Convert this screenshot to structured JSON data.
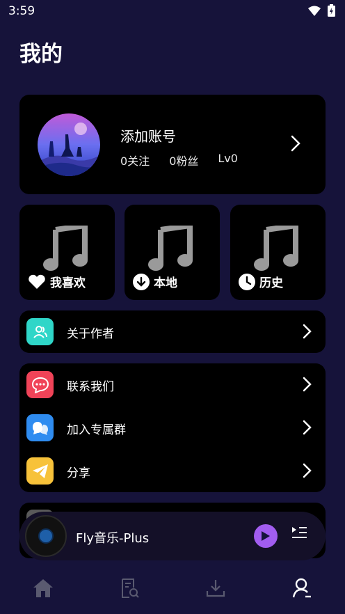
{
  "status": {
    "time": "3:59"
  },
  "page": {
    "title": "我的"
  },
  "profile": {
    "name": "添加账号",
    "following": "0关注",
    "followers": "0粉丝",
    "level": "Lv0"
  },
  "tiles": [
    {
      "label": "我喜欢",
      "icon": "heart-icon"
    },
    {
      "label": "本地",
      "icon": "download-icon"
    },
    {
      "label": "历史",
      "icon": "clock-icon"
    }
  ],
  "menu": {
    "about": {
      "label": "关于作者",
      "icon": "users-icon",
      "color": "#2fd6c8"
    },
    "contact": {
      "label": "联系我们",
      "icon": "message-icon",
      "color": "#f04358"
    },
    "join_group": {
      "label": "加入专属群",
      "icon": "group-chat-icon",
      "color": "#2f8cf0"
    },
    "share": {
      "label": "分享",
      "icon": "paper-plane-icon",
      "color": "#f7c23a"
    }
  },
  "player": {
    "title": "Fly音乐-Plus",
    "accent": "#a25df0"
  },
  "nav": {
    "items": [
      {
        "icon": "home-icon",
        "active": false
      },
      {
        "icon": "playlist-search-icon",
        "active": false
      },
      {
        "icon": "download-tray-icon",
        "active": false
      },
      {
        "icon": "user-icon",
        "active": true
      }
    ]
  },
  "colors": {
    "background": "#16133a",
    "card": "#000000"
  }
}
